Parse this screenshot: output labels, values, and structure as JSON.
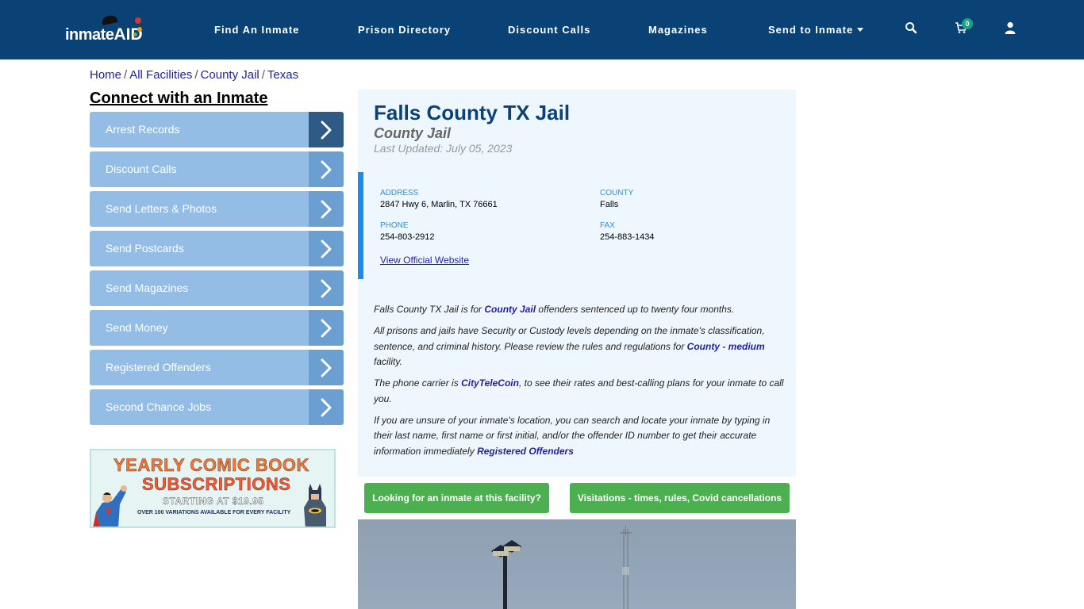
{
  "navbar": {
    "logo": {
      "text": "inmate",
      "accent": "AID"
    },
    "links": [
      {
        "label": "Find An Inmate"
      },
      {
        "label": "Prison Directory"
      },
      {
        "label": "Discount Calls"
      },
      {
        "label": "Magazines"
      },
      {
        "label": "Send to Inmate",
        "has_dropdown": true
      }
    ],
    "icons": [
      "search-icon",
      "cart-icon",
      "user-icon"
    ],
    "cart_count": "0",
    "colors": {
      "background": "#0b4275",
      "badge": "#1aa384"
    }
  },
  "breadcrumb": [
    {
      "label": "Home"
    },
    {
      "label": "All Facilities"
    },
    {
      "label": "County Jail"
    },
    {
      "label": "Texas"
    }
  ],
  "breadcrumb_separator": "/",
  "sidebar": {
    "title": "Connect with an Inmate",
    "items": [
      {
        "label": "Arrest Records",
        "active": true
      },
      {
        "label": "Discount Calls"
      },
      {
        "label": "Send Letters & Photos"
      },
      {
        "label": "Send Postcards"
      },
      {
        "label": "Send Magazines"
      },
      {
        "label": "Send Money"
      },
      {
        "label": "Registered Offenders"
      },
      {
        "label": "Second Chance Jobs"
      }
    ],
    "ad": {
      "line1": "YEARLY COMIC BOOK",
      "line2": "SUBSCRIPTIONS",
      "line3": "STARTING AT $19.95",
      "line4": "OVER 100 VARIATIONS AVAILABLE FOR EVERY FACILITY"
    }
  },
  "facility": {
    "title": "Falls County TX Jail",
    "type": "County Jail",
    "last_updated": "Last Updated: July 05, 2023",
    "info": {
      "address_label": "ADDRESS",
      "address": "2847 Hwy 6, Marlin, TX 76661",
      "county_label": "COUNTY",
      "county": "Falls",
      "phone_label": "PHONE",
      "phone": "254-803-2912",
      "fax_label": "FAX",
      "fax": "254-883-1434",
      "website_link": "View Official Website"
    },
    "description": {
      "p1_before": "Falls County TX Jail is for ",
      "p1_link": "County Jail",
      "p1_after": " offenders sentenced up to twenty four months.",
      "p2_before": "All prisons and jails have Security or Custody levels depending on the inmate's classification, sentence, and criminal history. Please review the rules and regulations for ",
      "p2_link": "County - medium",
      "p2_after": " facility.",
      "p3_before": "The phone carrier is ",
      "p3_link": "CityTeleCoin",
      "p3_after": ", to see their rates and best-calling plans for your inmate to call you.",
      "p4_before": "If you are unsure of your inmate's location, you can search and locate your inmate by typing in their last name, first name or first initial, and/or the offender ID number to get their accurate information immediately ",
      "p4_link": "Registered Offenders"
    },
    "buttons": {
      "find_inmate": "Looking for an inmate at this facility?",
      "visitations": "Visitations - times, rules, Covid cancellations"
    }
  }
}
